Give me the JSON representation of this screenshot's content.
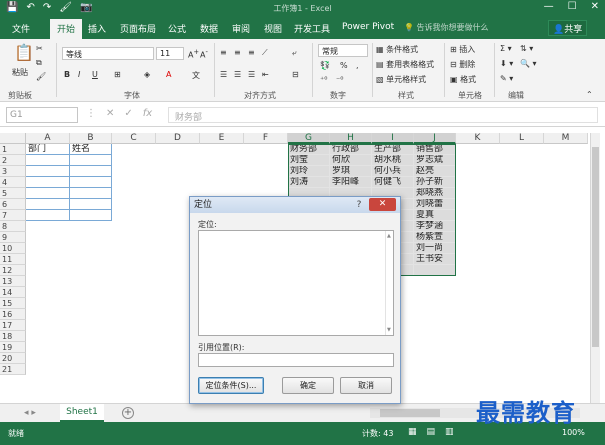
{
  "window": {
    "title": "工作簿1 - Excel",
    "quick_access": [
      "💾",
      "↶",
      "↷",
      "🖌",
      "📷"
    ],
    "controls": [
      "—",
      "☐",
      "✕"
    ]
  },
  "ribbon_tabs": [
    {
      "label": "文件",
      "active": false
    },
    {
      "label": "开始",
      "active": true
    },
    {
      "label": "插入",
      "active": false
    },
    {
      "label": "页面布局",
      "active": false
    },
    {
      "label": "公式",
      "active": false
    },
    {
      "label": "数据",
      "active": false
    },
    {
      "label": "审阅",
      "active": false
    },
    {
      "label": "视图",
      "active": false
    },
    {
      "label": "开发工具",
      "active": false
    },
    {
      "label": "Power Pivot",
      "active": false
    }
  ],
  "tell_me": "告诉我你想要做什么",
  "share_label": "共享",
  "ribbon": {
    "paste": "粘贴",
    "font_name": "等线",
    "font_size": "11",
    "number_format": "常规",
    "conditional_format": "条件格式",
    "table_format": "套用表格格式",
    "cell_style": "单元格样式",
    "insert": "插入",
    "delete": "删除",
    "format": "格式",
    "groups": {
      "clipboard": "剪贴板",
      "font": "字体",
      "alignment": "对齐方式",
      "number": "数字",
      "styles": "样式",
      "cells": "单元格",
      "editing": "编辑"
    }
  },
  "formula_bar": {
    "name_box": "G1",
    "fx": "fx",
    "content": "财务部"
  },
  "columns": [
    "A",
    "B",
    "C",
    "D",
    "E",
    "F",
    "G",
    "H",
    "I",
    "J",
    "K",
    "L",
    "M"
  ],
  "rows": [
    "1",
    "2",
    "3",
    "4",
    "5",
    "6",
    "7",
    "8",
    "9",
    "10",
    "11",
    "12",
    "13",
    "14",
    "15",
    "16",
    "17",
    "18",
    "19",
    "20",
    "21"
  ],
  "cells_ab": {
    "A1": "部门",
    "B1": "姓名"
  },
  "table_g_j": {
    "headers": [
      "财务部",
      "行政部",
      "生产部",
      "销售部"
    ],
    "rows": [
      [
        "刘莹",
        "何欣",
        "胡水桃",
        "罗志斌"
      ],
      [
        "刘玲",
        "罗琪",
        "何小兵",
        "赵亮"
      ],
      [
        "刘涛",
        "李阳峰",
        "何健飞",
        "孙子新"
      ],
      [
        "",
        "",
        "",
        "郑晓燕"
      ],
      [
        "",
        "",
        "",
        "刘晓蕾"
      ],
      [
        "",
        "",
        "",
        "夏真"
      ],
      [
        "",
        "",
        "",
        "李梦涵"
      ],
      [
        "",
        "",
        "",
        "杨紫萱"
      ],
      [
        "",
        "",
        "",
        "刘一尚"
      ],
      [
        "",
        "",
        "",
        "王书安"
      ]
    ]
  },
  "dialog": {
    "title": "定位",
    "help": "?",
    "close": "✕",
    "goto_label": "定位:",
    "reference_label": "引用位置(R):",
    "reference_value": "",
    "special_button": "定位条件(S)...",
    "ok_button": "确定",
    "cancel_button": "取消"
  },
  "sheet_tabs": {
    "active": "Sheet1",
    "add": "+"
  },
  "status": {
    "ready": "就绪",
    "count": "计数: 43",
    "zoom": "100%"
  },
  "watermark": "最需教育",
  "colors": {
    "excel_green": "#217346",
    "selection_fill": "#dcdcdc",
    "dialog_close_red": "#c9463d",
    "watermark_blue": "#1c5fc9"
  }
}
